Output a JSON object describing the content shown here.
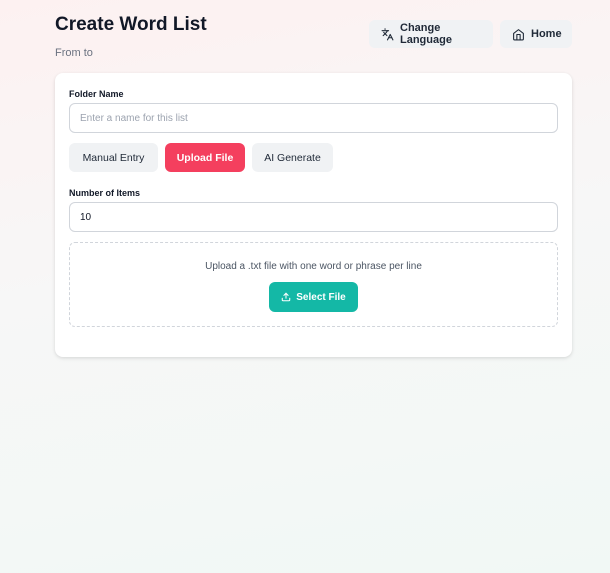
{
  "header": {
    "title": "Create Word List",
    "subtitle": "From to"
  },
  "top_nav": {
    "change_language_label": "Change Language",
    "home_label": "Home"
  },
  "form": {
    "folder_name": {
      "label": "Folder Name",
      "value": "",
      "placeholder": "Enter a name for this list"
    },
    "mode_tabs": [
      {
        "label": "Manual Entry",
        "active": false
      },
      {
        "label": "Upload File",
        "active": true
      },
      {
        "label": "AI Generate",
        "active": false
      }
    ],
    "number_of_items": {
      "label": "Number of Items",
      "value": "10"
    },
    "upload": {
      "instructions": "Upload a .txt file with one word or phrase per line",
      "button_label": "Select File"
    }
  },
  "colors": {
    "active_tab": "#f43f5e",
    "primary_action": "#14b8a6"
  }
}
